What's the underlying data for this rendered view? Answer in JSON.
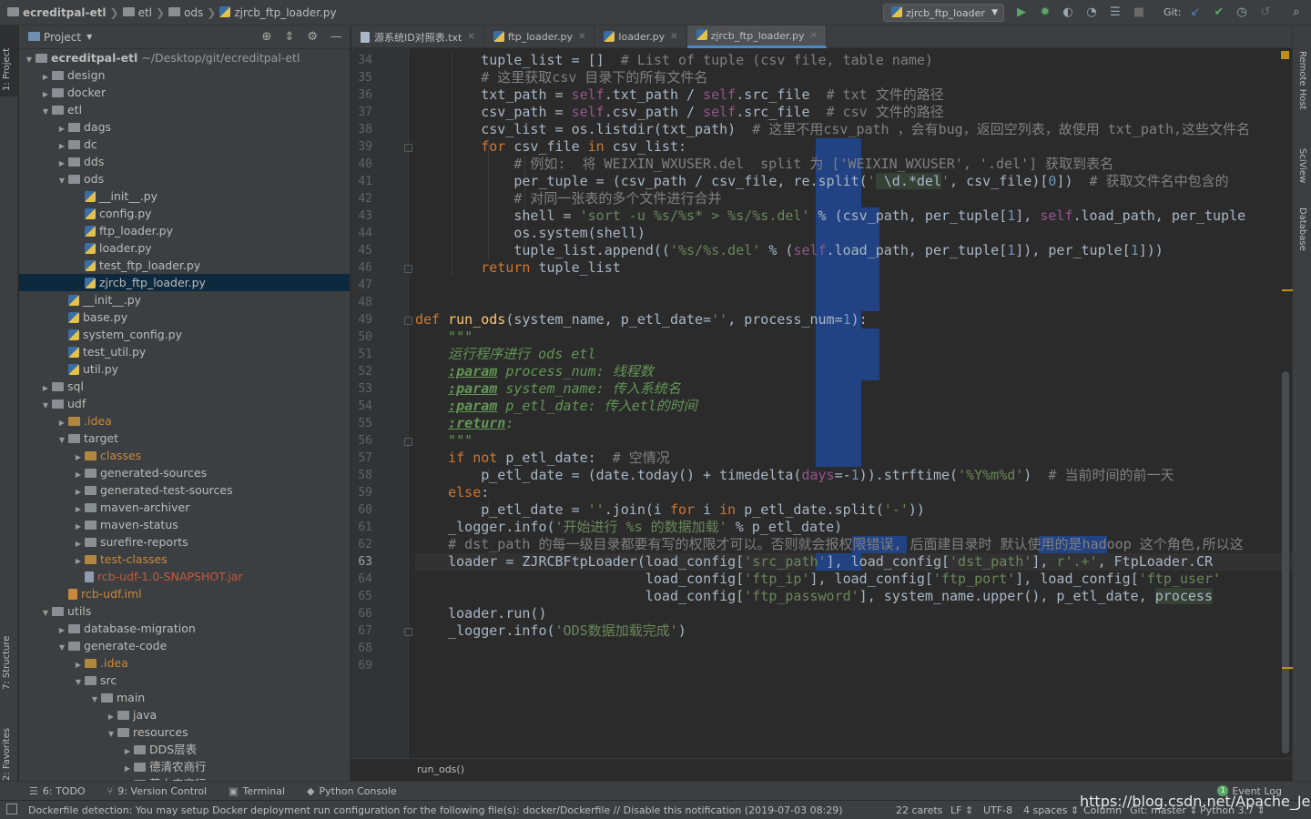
{
  "breadcrumb": [
    "ecreditpal-etl",
    "etl",
    "ods",
    "zjrcb_ftp_loader.py"
  ],
  "run_config": "zjrcb_ftp_loader",
  "git_label": "Git:",
  "left_tool_tabs": [
    "1: Project",
    "7: Structure",
    "2: Favorites"
  ],
  "right_tool_tabs": [
    "Remote Host",
    "SciView",
    "Database"
  ],
  "project_panel": {
    "title": "Project",
    "rows": [
      {
        "label": "ecreditpal-etl",
        "path": "~/Desktop/git/ecreditpal-etl",
        "depth": 0,
        "type": "folder",
        "open": true,
        "root": true
      },
      {
        "label": "design",
        "depth": 1,
        "type": "folder",
        "open": false
      },
      {
        "label": "docker",
        "depth": 1,
        "type": "folder",
        "open": false
      },
      {
        "label": "etl",
        "depth": 1,
        "type": "folder",
        "open": true
      },
      {
        "label": "dags",
        "depth": 2,
        "type": "folder",
        "open": false
      },
      {
        "label": "dc",
        "depth": 2,
        "type": "folder",
        "open": false
      },
      {
        "label": "dds",
        "depth": 2,
        "type": "folder",
        "open": false
      },
      {
        "label": "ods",
        "depth": 2,
        "type": "folder",
        "open": true
      },
      {
        "label": "__init__.py",
        "depth": 3,
        "type": "py"
      },
      {
        "label": "config.py",
        "depth": 3,
        "type": "py"
      },
      {
        "label": "ftp_loader.py",
        "depth": 3,
        "type": "py"
      },
      {
        "label": "loader.py",
        "depth": 3,
        "type": "py"
      },
      {
        "label": "test_ftp_loader.py",
        "depth": 3,
        "type": "py"
      },
      {
        "label": "zjrcb_ftp_loader.py",
        "depth": 3,
        "type": "py",
        "selected": true
      },
      {
        "label": "__init__.py",
        "depth": 2,
        "type": "py"
      },
      {
        "label": "base.py",
        "depth": 2,
        "type": "py"
      },
      {
        "label": "system_config.py",
        "depth": 2,
        "type": "py"
      },
      {
        "label": "test_util.py",
        "depth": 2,
        "type": "py"
      },
      {
        "label": "util.py",
        "depth": 2,
        "type": "py"
      },
      {
        "label": "sql",
        "depth": 1,
        "type": "folder",
        "open": false
      },
      {
        "label": "udf",
        "depth": 1,
        "type": "folder",
        "open": true
      },
      {
        "label": ".idea",
        "depth": 2,
        "type": "folder",
        "open": false,
        "color": "orange"
      },
      {
        "label": "target",
        "depth": 2,
        "type": "folder",
        "open": true
      },
      {
        "label": "classes",
        "depth": 3,
        "type": "folder",
        "open": false,
        "color": "orange"
      },
      {
        "label": "generated-sources",
        "depth": 3,
        "type": "folder",
        "open": false
      },
      {
        "label": "generated-test-sources",
        "depth": 3,
        "type": "folder",
        "open": false
      },
      {
        "label": "maven-archiver",
        "depth": 3,
        "type": "folder",
        "open": false
      },
      {
        "label": "maven-status",
        "depth": 3,
        "type": "folder",
        "open": false
      },
      {
        "label": "surefire-reports",
        "depth": 3,
        "type": "folder",
        "open": false
      },
      {
        "label": "test-classes",
        "depth": 3,
        "type": "folder",
        "open": false,
        "color": "orange"
      },
      {
        "label": "rcb-udf-1.0-SNAPSHOT.jar",
        "depth": 3,
        "type": "jar",
        "color": "red"
      },
      {
        "label": "rcb-udf.iml",
        "depth": 2,
        "type": "file",
        "color": "orange"
      },
      {
        "label": "utils",
        "depth": 1,
        "type": "folder",
        "open": true
      },
      {
        "label": "database-migration",
        "depth": 2,
        "type": "folder",
        "open": false
      },
      {
        "label": "generate-code",
        "depth": 2,
        "type": "folder",
        "open": true
      },
      {
        "label": ".idea",
        "depth": 3,
        "type": "folder",
        "open": false,
        "color": "orange"
      },
      {
        "label": "src",
        "depth": 3,
        "type": "folder",
        "open": true
      },
      {
        "label": "main",
        "depth": 4,
        "type": "folder",
        "open": true
      },
      {
        "label": "java",
        "depth": 5,
        "type": "folder",
        "open": false
      },
      {
        "label": "resources",
        "depth": 5,
        "type": "folder",
        "open": true
      },
      {
        "label": "DDS层表",
        "depth": 6,
        "type": "folder",
        "open": false
      },
      {
        "label": "德清农商行",
        "depth": 6,
        "type": "folder",
        "open": false
      },
      {
        "label": "萧山农商行",
        "depth": 6,
        "type": "folder",
        "open": false
      }
    ]
  },
  "tabs": [
    {
      "label": "源系统ID对照表.txt",
      "icon": "txt"
    },
    {
      "label": "ftp_loader.py",
      "icon": "py"
    },
    {
      "label": "loader.py",
      "icon": "py"
    },
    {
      "label": "zjrcb_ftp_loader.py",
      "icon": "py",
      "active": true
    }
  ],
  "line_numbers": [
    34,
    35,
    36,
    37,
    38,
    39,
    40,
    41,
    42,
    43,
    44,
    45,
    46,
    47,
    48,
    49,
    50,
    51,
    52,
    53,
    54,
    55,
    56,
    57,
    58,
    59,
    60,
    61,
    62,
    63,
    64,
    65,
    66,
    67,
    68,
    69
  ],
  "current_line": 63,
  "code_lines": [
    [
      [
        "        tuple_list = []  ",
        ""
      ],
      [
        "# List of tuple (csv file, table name)",
        "cm"
      ]
    ],
    [
      [
        "        ",
        ""
      ],
      [
        "# 这里获取csv 目录下的所有文件名",
        "cm"
      ]
    ],
    [
      [
        "        txt_path = ",
        ""
      ],
      [
        "self",
        "sf"
      ],
      [
        ".txt_path / ",
        ""
      ],
      [
        "self",
        "sf"
      ],
      [
        ".src_file  ",
        ""
      ],
      [
        "# txt 文件的路径",
        "cm"
      ]
    ],
    [
      [
        "        csv_path = ",
        ""
      ],
      [
        "self",
        "sf"
      ],
      [
        ".csv_path / ",
        ""
      ],
      [
        "self",
        "sf"
      ],
      [
        ".src_file  ",
        ""
      ],
      [
        "# csv 文件的路径",
        "cm"
      ]
    ],
    [
      [
        "        csv_list = os.listdir(txt_path)  ",
        ""
      ],
      [
        "# 这里不用csv_path ，会有bug，返回空列表，故使用 txt_path,这些文件名",
        "cm"
      ]
    ],
    [
      [
        "        ",
        ""
      ],
      [
        "for",
        "k"
      ],
      [
        " csv_file ",
        ""
      ],
      [
        "in",
        "k"
      ],
      [
        " csv_list:",
        ""
      ]
    ],
    [
      [
        "            ",
        ""
      ],
      [
        "# 例如:  将 WEIXIN_WXUSER.del  split 为 ['WEIXIN_WXUSER', '.del'] 获取到表名",
        "cm"
      ]
    ],
    [
      [
        "            per_tuple = (csv_path / csv_file, re.split(",
        ""
      ],
      [
        "'",
        "s"
      ],
      [
        " \\d.*del",
        "re"
      ],
      [
        "'",
        "s"
      ],
      [
        ", csv_file)[",
        ""
      ],
      [
        "0",
        "num"
      ],
      [
        "])  ",
        ""
      ],
      [
        "# 获取文件名中包含的",
        "cm"
      ]
    ],
    [
      [
        "            ",
        ""
      ],
      [
        "# 对同一张表的多个文件进行合并",
        "cm"
      ]
    ],
    [
      [
        "            shell = ",
        ""
      ],
      [
        "'sort -u %s/%s* > %s/%s.del'",
        "s"
      ],
      [
        " % (csv_path, per_tuple[",
        ""
      ],
      [
        "1",
        "num"
      ],
      [
        "], ",
        ""
      ],
      [
        "self",
        "sf"
      ],
      [
        ".load_path, per_tuple",
        ""
      ]
    ],
    [
      [
        "            os.system(shell)",
        ""
      ]
    ],
    [
      [
        "            tuple_list.append((",
        ""
      ],
      [
        "'%s/%s.del'",
        "s"
      ],
      [
        " % (",
        ""
      ],
      [
        "self",
        "sf"
      ],
      [
        ".load_path, per_tuple[",
        ""
      ],
      [
        "1",
        "num"
      ],
      [
        "]), per_tuple[",
        ""
      ],
      [
        "1",
        "num"
      ],
      [
        "]))",
        ""
      ]
    ],
    [
      [
        "        ",
        ""
      ],
      [
        "return",
        "k"
      ],
      [
        " tuple_list",
        ""
      ]
    ],
    [
      [
        "",
        ""
      ]
    ],
    [
      [
        "",
        ""
      ]
    ],
    [
      [
        "def",
        "k"
      ],
      [
        " ",
        ""
      ],
      [
        "run_ods",
        "fn"
      ],
      [
        "(system_name, p_etl_date=",
        ""
      ],
      [
        "''",
        "s"
      ],
      [
        ", process_num=",
        ""
      ],
      [
        "1",
        "num"
      ],
      [
        "):",
        ""
      ]
    ],
    [
      [
        "    ",
        ""
      ],
      [
        "\"\"\"",
        "doc"
      ]
    ],
    [
      [
        "    ",
        ""
      ],
      [
        "运行程序进行 ods etl",
        "doc"
      ]
    ],
    [
      [
        "    ",
        ""
      ],
      [
        ":param",
        "doctag"
      ],
      [
        " process_num: 线程数",
        "doc"
      ]
    ],
    [
      [
        "    ",
        ""
      ],
      [
        ":param",
        "doctag"
      ],
      [
        " system_name: 传入系统名",
        "doc"
      ]
    ],
    [
      [
        "    ",
        ""
      ],
      [
        ":param",
        "doctag"
      ],
      [
        " p_etl_date: 传入etl的时间",
        "doc"
      ]
    ],
    [
      [
        "    ",
        ""
      ],
      [
        ":return",
        "doctag"
      ],
      [
        ":",
        "doc"
      ]
    ],
    [
      [
        "    ",
        ""
      ],
      [
        "\"\"\"",
        "doc"
      ]
    ],
    [
      [
        "    ",
        ""
      ],
      [
        "if",
        "k"
      ],
      [
        " ",
        ""
      ],
      [
        "not",
        "k"
      ],
      [
        " p_etl_date:  ",
        ""
      ],
      [
        "# 空情况",
        "cm"
      ]
    ],
    [
      [
        "        p_etl_date = (date.today() + timedelta(",
        ""
      ],
      [
        "days",
        "sf"
      ],
      [
        "=-",
        ""
      ],
      [
        "1",
        "num"
      ],
      [
        ")).strftime(",
        ""
      ],
      [
        "'%Y%m%d'",
        "s"
      ],
      [
        ")  ",
        ""
      ],
      [
        "# 当前时间的前一天",
        "cm"
      ]
    ],
    [
      [
        "    ",
        ""
      ],
      [
        "else",
        "k"
      ],
      [
        ":",
        ""
      ]
    ],
    [
      [
        "        p_etl_date = ",
        ""
      ],
      [
        "''",
        "s"
      ],
      [
        ".join(i ",
        ""
      ],
      [
        "for",
        "k"
      ],
      [
        " i ",
        ""
      ],
      [
        "in",
        "k"
      ],
      [
        " p_etl_date.split(",
        ""
      ],
      [
        "'-'",
        "s"
      ],
      [
        "))",
        ""
      ]
    ],
    [
      [
        "    _logger.info(",
        ""
      ],
      [
        "'开始进行 %s 的数据加载'",
        "s"
      ],
      [
        " % p_etl_date)",
        ""
      ]
    ],
    [
      [
        "    ",
        ""
      ],
      [
        "# dst_path 的每一级目录都要有写的权限才可以。否则就会报权限错误, 后面建目录时 默认使用的是hadoop 这个角色,所以这",
        "cm"
      ]
    ],
    [
      [
        "    loader = ZJRCBFtpLoader(load_config[",
        ""
      ],
      [
        "'src_path'",
        "s"
      ],
      [
        "], load_config[",
        ""
      ],
      [
        "'dst_path'",
        "s"
      ],
      [
        "], ",
        ""
      ],
      [
        "r'.+'",
        "s"
      ],
      [
        ", FtpLoader.CR",
        ""
      ]
    ],
    [
      [
        "                            load_config[",
        ""
      ],
      [
        "'ftp_ip'",
        "s"
      ],
      [
        "], load_config[",
        ""
      ],
      [
        "'ftp_port'",
        "s"
      ],
      [
        "], load_config[",
        ""
      ],
      [
        "'ftp_user'",
        "s"
      ]
    ],
    [
      [
        "                            load_config[",
        ""
      ],
      [
        "'ftp_password'",
        "s"
      ],
      [
        "], system_name.upper(), p_etl_date, ",
        ""
      ],
      [
        "process",
        "re"
      ]
    ],
    [
      [
        "    loader.run()",
        ""
      ]
    ],
    [
      [
        "    _logger.info(",
        ""
      ],
      [
        "'ODS数据加载完成'",
        "s"
      ],
      [
        ")",
        ""
      ]
    ],
    [
      [
        "",
        ""
      ]
    ],
    [
      [
        "",
        ""
      ]
    ]
  ],
  "editor_breadcrumb": "run_ods()",
  "bottom_tools": [
    {
      "icon": "☰",
      "label": "6: TODO"
    },
    {
      "icon": "⑂",
      "label": "9: Version Control"
    },
    {
      "icon": "▣",
      "label": "Terminal"
    },
    {
      "icon": "◆",
      "label": "Python Console"
    }
  ],
  "event_log": {
    "count": "1",
    "label": "Event Log"
  },
  "status": {
    "message": "Dockerfile detection: You may setup Docker deployment run configuration for the following file(s): docker/Dockerfile // Disable this notification (2019-07-03 08:29)",
    "carets": "22 carets",
    "line_sep": "LF ⇕",
    "encoding": "UTF-8",
    "indent": "4 spaces ⇕",
    "column": "Column",
    "git": "Git: master ⇕",
    "interpreter": "Python 3.7 ⇕"
  },
  "watermark": "https://blog.csdn.net/Apache_Jerry"
}
